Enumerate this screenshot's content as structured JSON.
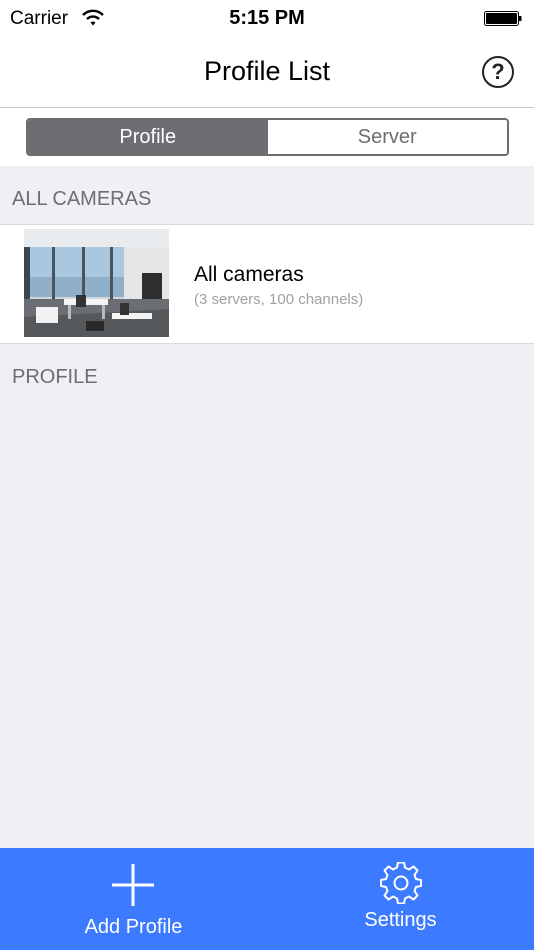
{
  "status_bar": {
    "carrier": "Carrier",
    "time": "5:15 PM"
  },
  "nav": {
    "title": "Profile List",
    "help_symbol": "?"
  },
  "segments": [
    {
      "label": "Profile",
      "selected": true
    },
    {
      "label": "Server",
      "selected": false
    }
  ],
  "sections": {
    "all_cameras": "ALL CAMERAS",
    "profile": "PROFILE"
  },
  "all_cameras_row": {
    "title": "All cameras",
    "subtitle": "(3 servers, 100 channels)"
  },
  "tab_bar": {
    "add_label": "Add Profile",
    "settings_label": "Settings"
  },
  "colors": {
    "tab_bar": "#3c7aff",
    "segment_active": "#6d6d72",
    "background": "#efeff4"
  },
  "icons": [
    "wifi-icon",
    "battery-icon",
    "help-icon",
    "plus-icon",
    "gear-icon"
  ]
}
